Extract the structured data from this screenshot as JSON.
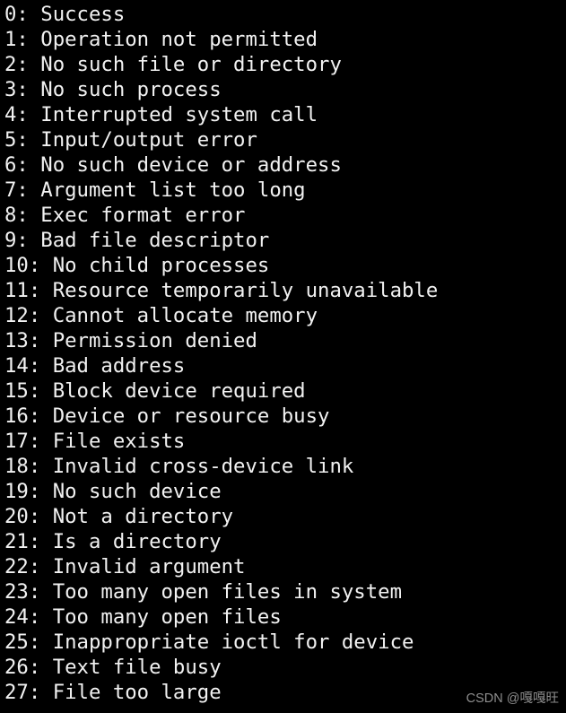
{
  "terminal": {
    "background_color": "#000000",
    "text_color": "#f2f2f2",
    "font_size_px": 22,
    "line_height_px": 28,
    "lines": [
      "0: Success",
      "1: Operation not permitted",
      "2: No such file or directory",
      "3: No such process",
      "4: Interrupted system call",
      "5: Input/output error",
      "6: No such device or address",
      "7: Argument list too long",
      "8: Exec format error",
      "9: Bad file descriptor",
      "10: No child processes",
      "11: Resource temporarily unavailable",
      "12: Cannot allocate memory",
      "13: Permission denied",
      "14: Bad address",
      "15: Block device required",
      "16: Device or resource busy",
      "17: File exists",
      "18: Invalid cross-device link",
      "19: No such device",
      "20: Not a directory",
      "21: Is a directory",
      "22: Invalid argument",
      "23: Too many open files in system",
      "24: Too many open files",
      "25: Inappropriate ioctl for device",
      "26: Text file busy",
      "27: File too large"
    ]
  },
  "watermark": {
    "text": "CSDN @嘎嘎旺",
    "color": "#8d8d8d"
  }
}
